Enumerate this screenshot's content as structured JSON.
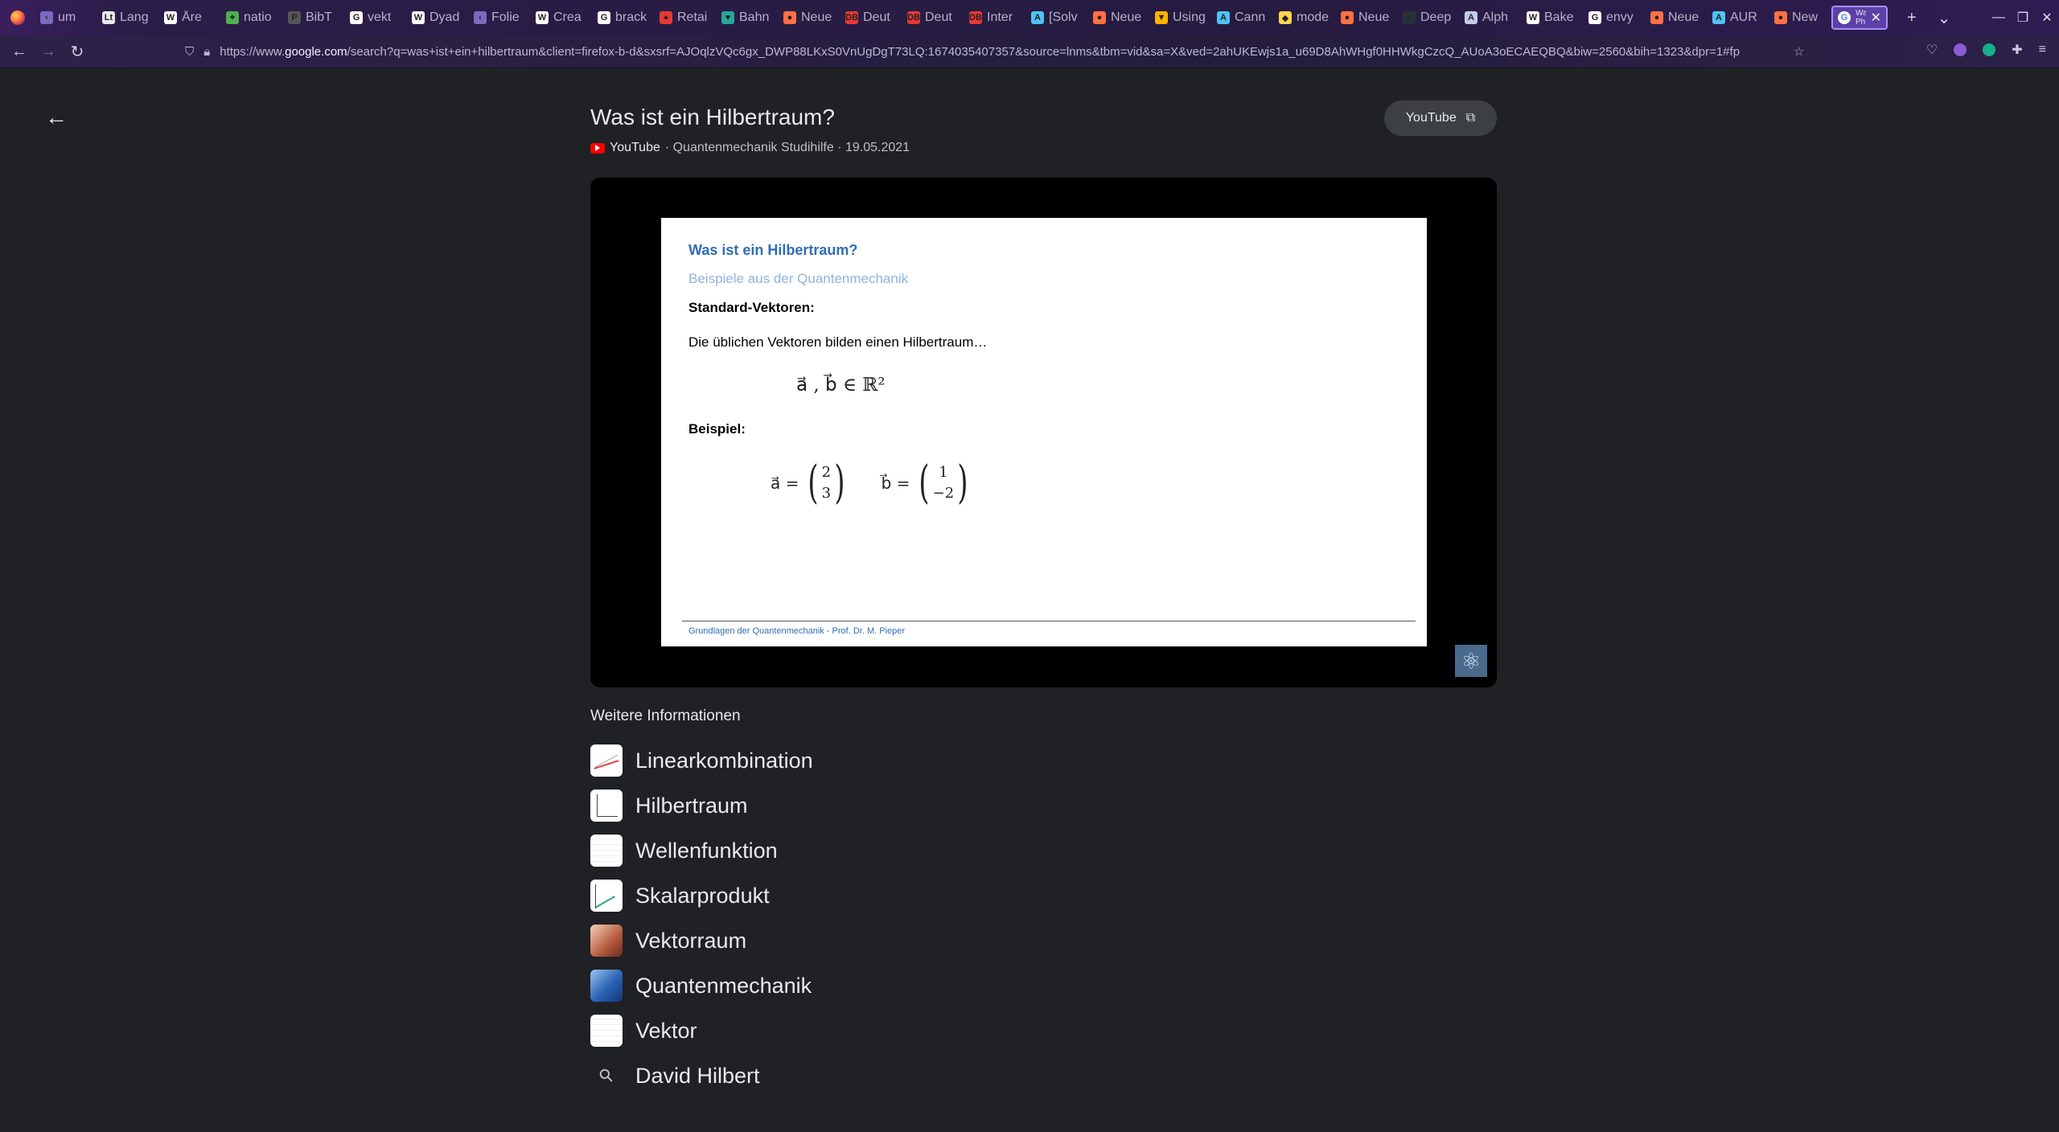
{
  "browser": {
    "tabs": [
      {
        "label": "um",
        "fav": "‹",
        "color": "#7a6ac0"
      },
      {
        "label": "Lang",
        "fav": "Lt",
        "color": "#e8e8e8"
      },
      {
        "label": "Åre",
        "fav": "W",
        "color": "#ffffff"
      },
      {
        "label": "natio",
        "fav": "⌖",
        "color": "#4caf50"
      },
      {
        "label": "BibT",
        "fav": "P",
        "color": "#555555"
      },
      {
        "label": "vekt",
        "fav": "G",
        "color": "#ffffff"
      },
      {
        "label": "Dyad",
        "fav": "W",
        "color": "#ffffff"
      },
      {
        "label": "Folie",
        "fav": "‹",
        "color": "#7a6ac0"
      },
      {
        "label": "Crea",
        "fav": "W",
        "color": "#ffffff"
      },
      {
        "label": "brack",
        "fav": "G",
        "color": "#ffffff"
      },
      {
        "label": "Retai",
        "fav": "✦",
        "color": "#e53935"
      },
      {
        "label": "Bahn",
        "fav": "♥",
        "color": "#26a69a"
      },
      {
        "label": "Neue",
        "fav": "●",
        "color": "#ff7043"
      },
      {
        "label": "Deut",
        "fav": "DB",
        "color": "#e53935"
      },
      {
        "label": "Deut",
        "fav": "DB",
        "color": "#e53935"
      },
      {
        "label": "Inter",
        "fav": "DB",
        "color": "#e53935"
      },
      {
        "label": "[Solv",
        "fav": "A",
        "color": "#4fc3f7"
      },
      {
        "label": "Neue",
        "fav": "●",
        "color": "#ff7043"
      },
      {
        "label": "Using",
        "fav": "▼",
        "color": "#ffb300"
      },
      {
        "label": "Cann",
        "fav": "A",
        "color": "#4fc3f7"
      },
      {
        "label": "mode",
        "fav": "◆",
        "color": "#ffd54f"
      },
      {
        "label": "Neue",
        "fav": "●",
        "color": "#ff7043"
      },
      {
        "label": "Deep",
        "fav": "◐",
        "color": "#263238"
      },
      {
        "label": "Alph",
        "fav": "A",
        "color": "#c5cae9"
      },
      {
        "label": "Bake",
        "fav": "W",
        "color": "#ffffff"
      },
      {
        "label": "envy",
        "fav": "G",
        "color": "#ffffff"
      },
      {
        "label": "Neue",
        "fav": "●",
        "color": "#ff7043"
      },
      {
        "label": "AUR",
        "fav": "A",
        "color": "#4fc3f7"
      },
      {
        "label": "New",
        "fav": "●",
        "color": "#ff7043"
      }
    ],
    "active_tab": {
      "label": "Wa… Ph…",
      "fav": "G"
    },
    "new_tab": "+",
    "list_tabs": "⌄",
    "url_prefix": "https://www.",
    "url_domain": "google.com",
    "url_rest": "/search?q=was+ist+ein+hilbertraum&client=firefox-b-d&sxsrf=AJOqlzVQc6gx_DWP88LKxS0VnUgDgT73LQ:1674035407357&source=lnms&tbm=vid&sa=X&ved=2ahUKEwjs1a_u69D8AhWHgf0HHWkgCzcQ_AUoA3oECAEQBQ&biw=2560&bih=1323&dpr=1#fp"
  },
  "video": {
    "title": "Was ist ein Hilbertraum?",
    "source": "YouTube",
    "meta": "· Quantenmechanik Studihilfe · 19.05.2021",
    "open_button": "YouTube"
  },
  "slide": {
    "title": "Was ist ein Hilbertraum?",
    "subtitle": "Beispiele aus der Quantenmechanik",
    "heading1": "Standard-Vektoren:",
    "text1": "Die üblichen Vektoren bilden einen Hilbertraum…",
    "math1": "a⃗ , b⃗ ∈ ℝ²",
    "heading2": "Beispiel:",
    "vec_a_label": "a⃗ =",
    "vec_a": [
      "2",
      "3"
    ],
    "vec_b_label": "b⃗ =",
    "vec_b": [
      "1",
      "−2"
    ],
    "footer": "Grundlagen der Quantenmechanik - Prof. Dr. M. Pieper"
  },
  "more_info": {
    "heading": "Weitere Informationen",
    "items": [
      {
        "label": "Linearkombination",
        "thumb": "lines"
      },
      {
        "label": "Hilbertraum",
        "thumb": "axes"
      },
      {
        "label": "Wellenfunktion",
        "thumb": "grid"
      },
      {
        "label": "Skalarprodukt",
        "thumb": "green"
      },
      {
        "label": "Vektorraum",
        "thumb": "warm"
      },
      {
        "label": "Quantenmechanik",
        "thumb": "blue"
      },
      {
        "label": "Vektor",
        "thumb": "grid"
      },
      {
        "label": "David Hilbert",
        "thumb": "search"
      }
    ]
  }
}
